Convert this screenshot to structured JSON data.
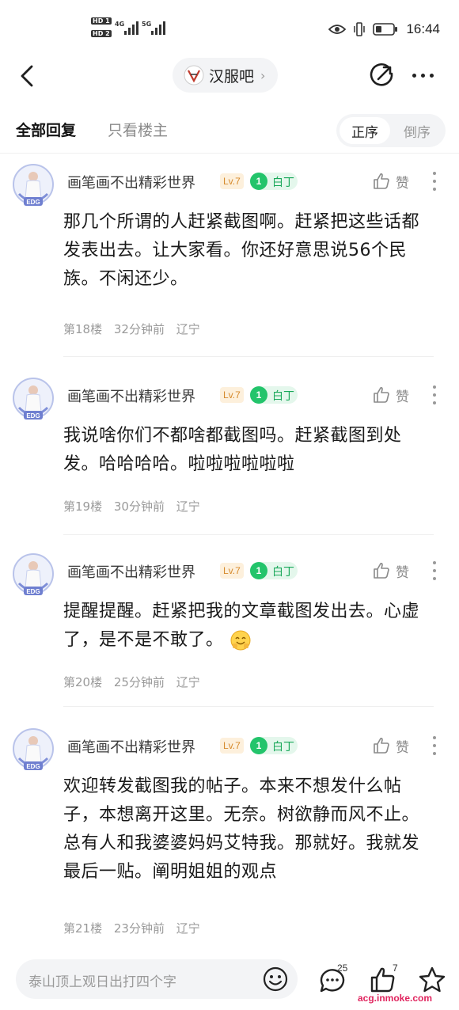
{
  "status_bar": {
    "sim1": "HD 1",
    "sim2": "HD 2",
    "net1": "4G",
    "net2": "5G",
    "time": "16:44"
  },
  "nav": {
    "forum_name": "汉服吧",
    "forum_chevron": "›"
  },
  "filter": {
    "tab_all": "全部回复",
    "tab_op_only": "只看楼主",
    "sort_asc": "正序",
    "sort_desc": "倒序"
  },
  "posts": [
    {
      "username": "画笔画不出精彩世界",
      "level": "Lv.7",
      "badge_num": "1",
      "badge": "白丁",
      "like_label": "赞",
      "content": "那几个所谓的人赶紧截图啊。赶紧把这些话都发表出去。让大家看。你还好意思说56个民族。不闲还少。",
      "floor": "第18楼",
      "time": "32分钟前",
      "location": "辽宁"
    },
    {
      "username": "画笔画不出精彩世界",
      "level": "Lv.7",
      "badge_num": "1",
      "badge": "白丁",
      "like_label": "赞",
      "content": "我说啥你们不都啥都截图吗。赶紧截图到处发。哈哈哈哈。啦啦啦啦啦啦",
      "floor": "第19楼",
      "time": "30分钟前",
      "location": "辽宁"
    },
    {
      "username": "画笔画不出精彩世界",
      "level": "Lv.7",
      "badge_num": "1",
      "badge": "白丁",
      "like_label": "赞",
      "content": "提醒提醒。赶紧把我的文章截图发出去。心虚了，是不是不敢了。",
      "floor": "第20楼",
      "time": "25分钟前",
      "location": "辽宁"
    },
    {
      "username": "画笔画不出精彩世界",
      "level": "Lv.7",
      "badge_num": "1",
      "badge": "白丁",
      "like_label": "赞",
      "content": "欢迎转发截图我的帖子。本来不想发什么帖子，本想离开这里。无奈。树欲静而风不止。总有人和我婆婆妈妈艾特我。那就好。我就发最后一贴。阐明姐姐的观点",
      "floor": "第21楼",
      "time": "23分钟前",
      "location": "辽宁"
    }
  ],
  "bottom_bar": {
    "reply_placeholder": "泰山顶上观日出打四个字",
    "comment_count": "25",
    "like_count": "7"
  },
  "watermark": "acg.inmoke.com",
  "colors": {
    "accent_green": "#23c46b",
    "level_orange": "#d68a2c",
    "watermark_red": "#e0245e"
  }
}
